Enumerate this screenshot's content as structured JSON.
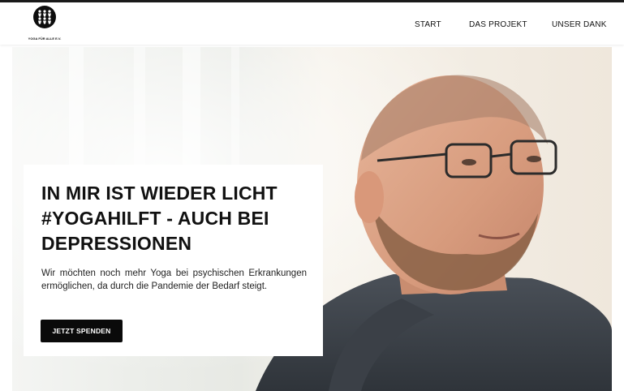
{
  "brand": {
    "logo_text": "YOGA FÜR ALLE E.V."
  },
  "nav": {
    "items": [
      "START",
      "DAS PROJEKT",
      "UNSER DANK"
    ]
  },
  "hero": {
    "headline": "IN MIR IST WIEDER LICHT #YOGAHILFT - AUCH BEI DEPRESSIONEN",
    "subtext": "Wir möchten noch mehr Yoga bei psychischen Erkrankungen ermöglichen, da durch die Pandemie der Bedarf steigt.",
    "cta_label": "JETZT SPENDEN"
  },
  "colors": {
    "accent": "#0a0a0a",
    "background": "#ffffff"
  },
  "icons": [
    "logo-badge-icon"
  ]
}
